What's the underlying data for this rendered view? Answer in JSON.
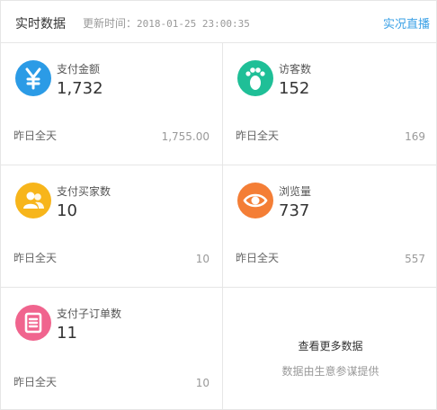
{
  "header": {
    "title": "实时数据",
    "updated_label": "更新时间：",
    "updated_time": "2018-01-25 23:00:35",
    "live_link": "实况直播"
  },
  "metrics": [
    {
      "icon": "yen-icon",
      "color": "#2b9be6",
      "label": "支付金额",
      "value": "1,732",
      "prev_label": "昨日全天",
      "prev_value": "1,755.00"
    },
    {
      "icon": "footprint-icon",
      "color": "#1fbf97",
      "label": "访客数",
      "value": "152",
      "prev_label": "昨日全天",
      "prev_value": "169"
    },
    {
      "icon": "users-icon",
      "color": "#f7b51b",
      "label": "支付买家数",
      "value": "10",
      "prev_label": "昨日全天",
      "prev_value": "10"
    },
    {
      "icon": "eye-icon",
      "color": "#f47e36",
      "label": "浏览量",
      "value": "737",
      "prev_label": "昨日全天",
      "prev_value": "557"
    },
    {
      "icon": "order-icon",
      "color": "#f0648e",
      "label": "支付子订单数",
      "value": "11",
      "prev_label": "昨日全天",
      "prev_value": "10"
    }
  ],
  "more": {
    "title": "查看更多数据",
    "subtitle": "数据由生意参谋提供"
  }
}
